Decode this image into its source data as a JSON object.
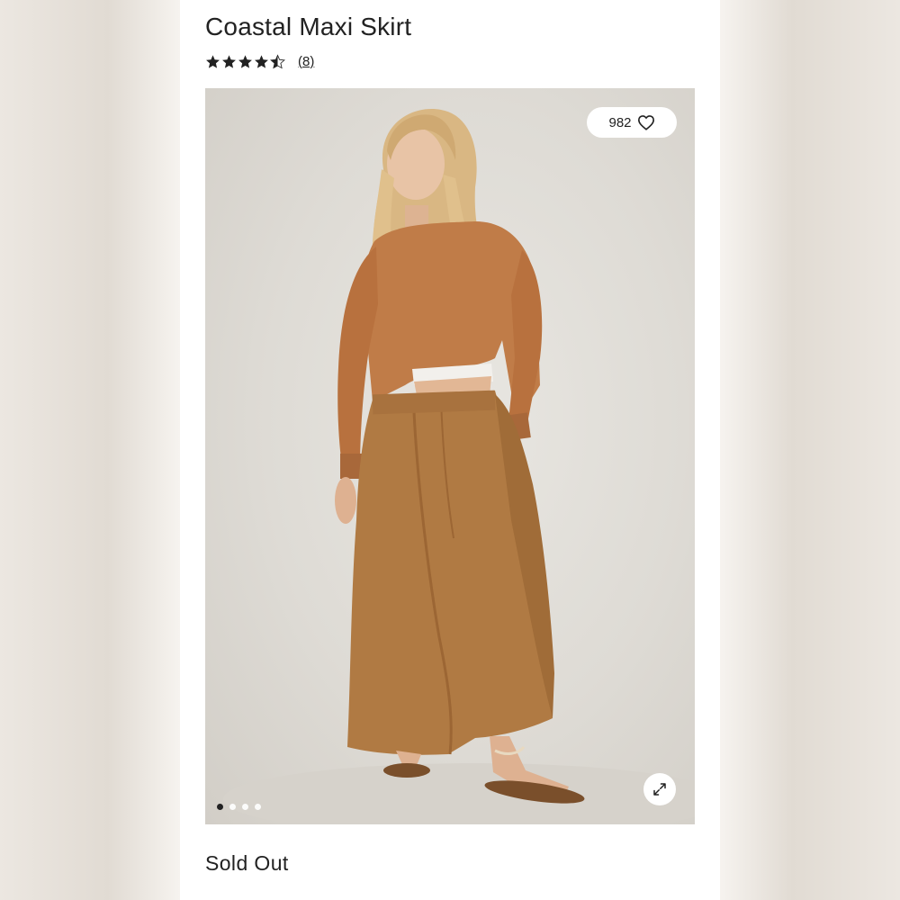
{
  "product": {
    "title": "Coastal Maxi Skirt",
    "rating": 4.5,
    "rating_max": 5,
    "review_count": "(8)",
    "like_count": "982",
    "status": "Sold Out"
  },
  "gallery": {
    "image_count": 4,
    "active_index": 0
  },
  "icons": {
    "star": "star-icon",
    "half_star": "half-star-icon",
    "like": "heart-icon",
    "expand": "expand-icon"
  },
  "colors": {
    "text": "#222222",
    "panel": "#ffffff",
    "sweater": "#c07c48",
    "skirt": "#b07a43"
  }
}
